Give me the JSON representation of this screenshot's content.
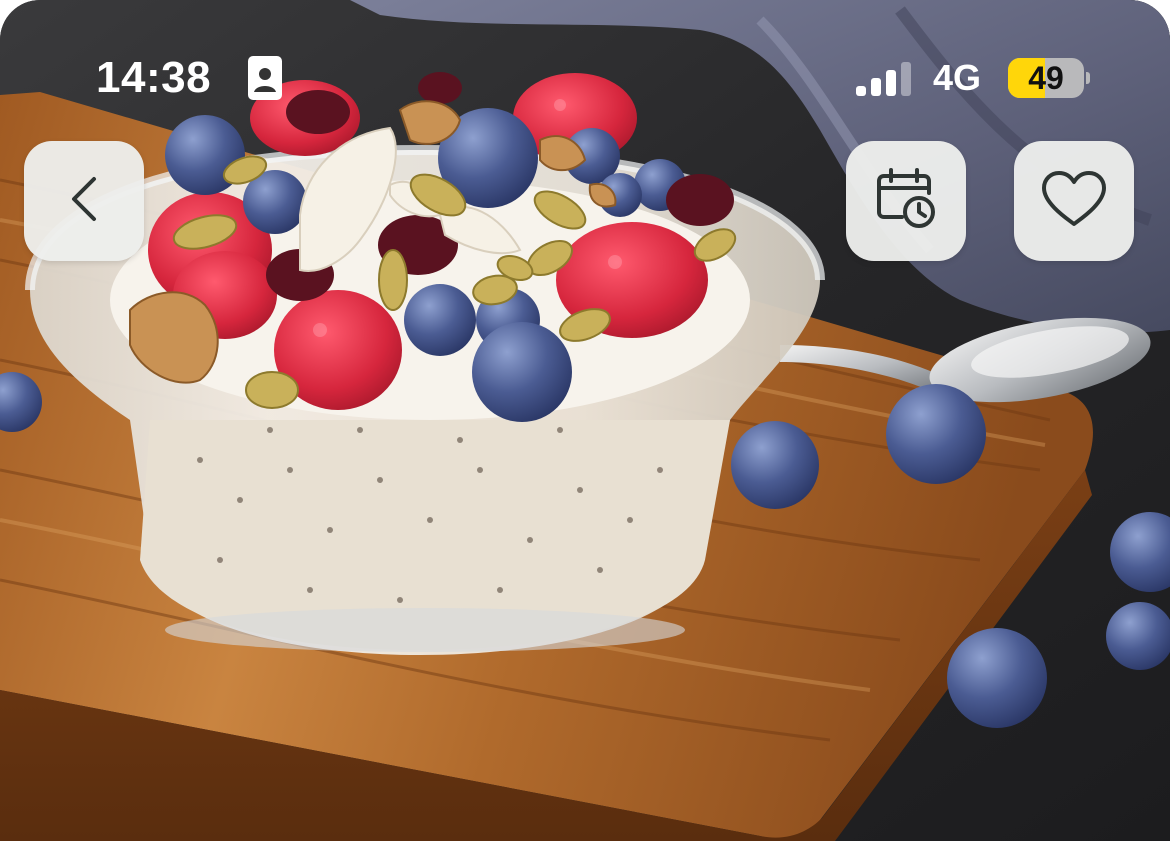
{
  "status_bar": {
    "time": "14:38",
    "network": "4G",
    "battery_level": "49",
    "battery_fraction": 0.49,
    "signal_bars_active": 3,
    "signal_bars_total": 4
  },
  "toolbar": {
    "back_icon": "chevron-left-icon",
    "schedule_icon": "calendar-clock-icon",
    "favorite_icon": "heart-icon"
  },
  "hero": {
    "image_subject": "chia-overnight-oats-bowl-with-berries"
  },
  "colors": {
    "button_bg": "#edeeec",
    "icon_stroke": "#2e3533",
    "battery_accent": "#ffd60a"
  }
}
